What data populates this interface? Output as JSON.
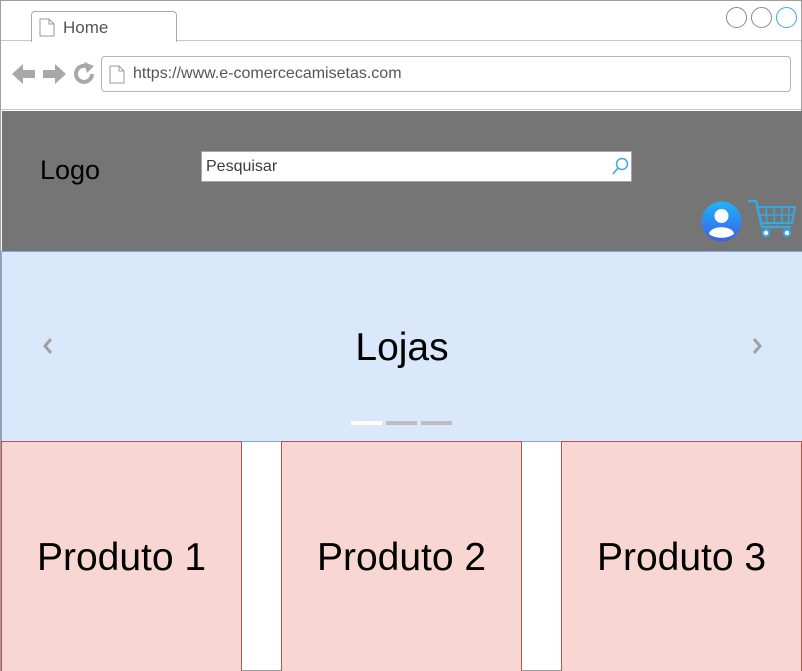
{
  "browser": {
    "tab_title": "Home",
    "url": "https://www.e-comercecamisetas.com",
    "accent_color": "#36a9e1"
  },
  "header": {
    "logo_text": "Logo",
    "search_placeholder": "Pesquisar",
    "background_color": "#757575",
    "icons": [
      "search-icon",
      "user-avatar-icon",
      "shopping-cart-icon"
    ]
  },
  "carousel": {
    "title": "Lojas",
    "slide_count": 3,
    "active_slide": 1,
    "background_color": "#dae8fc"
  },
  "products": [
    {
      "label": "Produto 1"
    },
    {
      "label": "Produto 2"
    },
    {
      "label": "Produto 3"
    }
  ],
  "product_card_color": "#f8d7d3"
}
